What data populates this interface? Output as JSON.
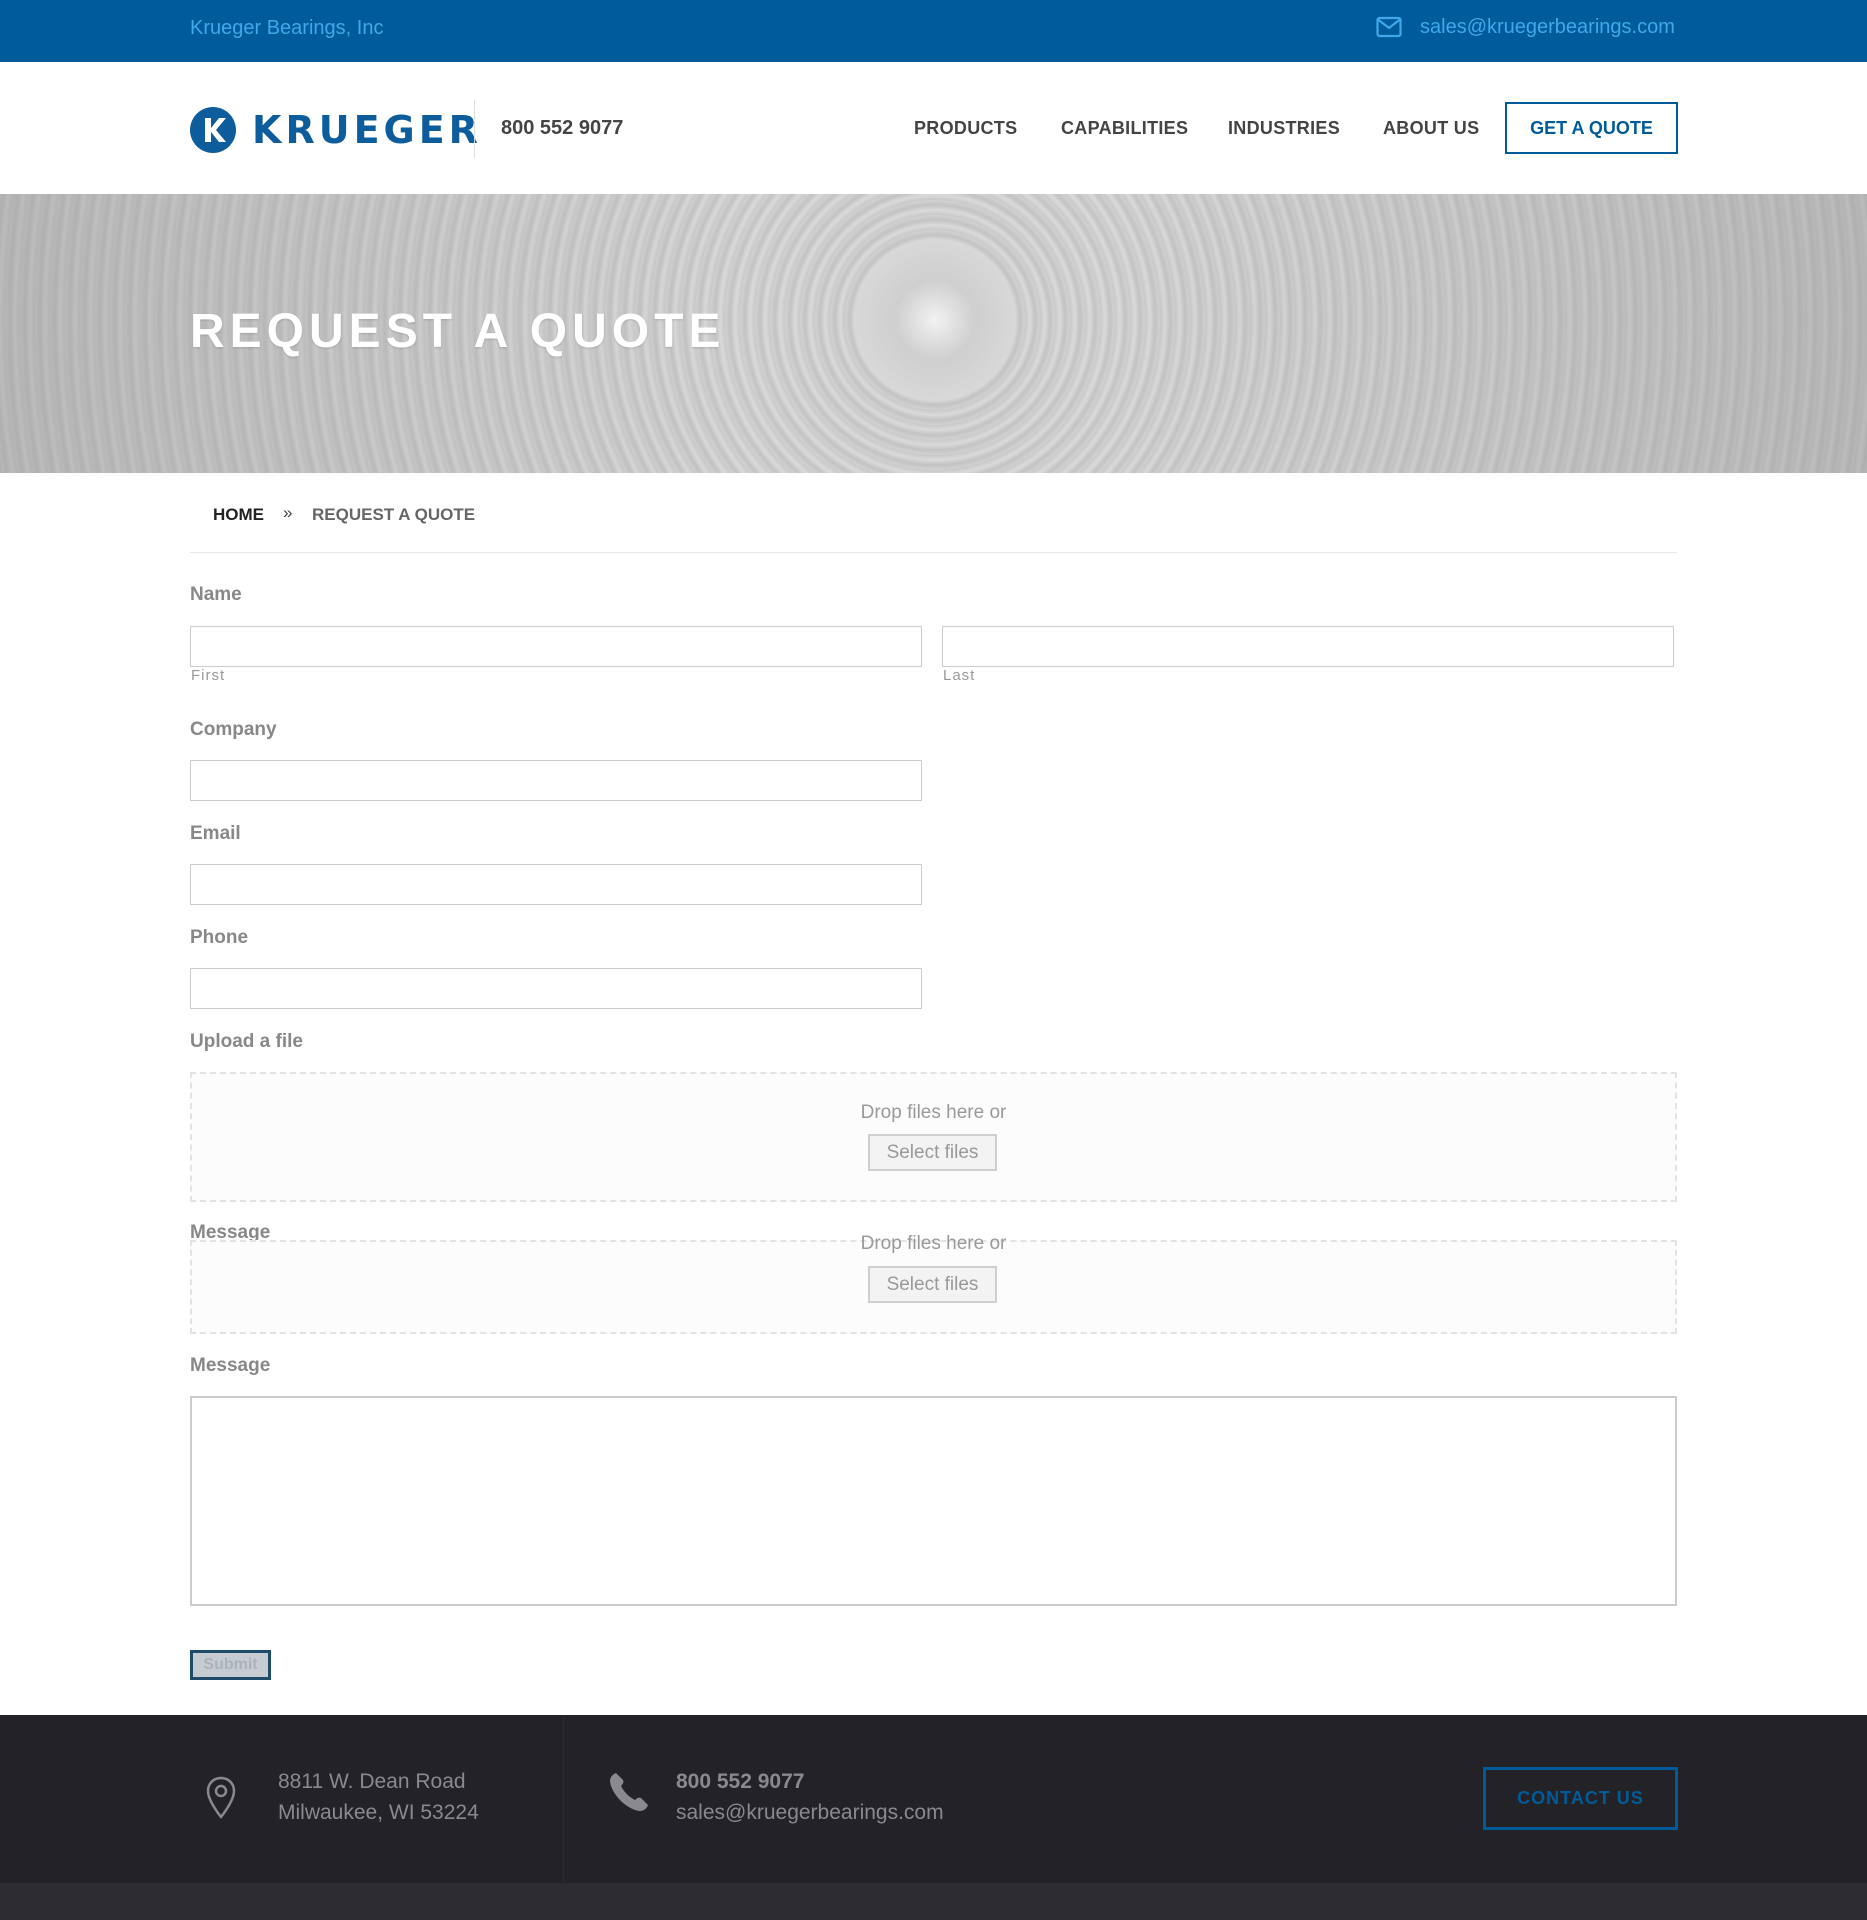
{
  "topbar": {
    "company": "Krueger Bearings, Inc",
    "email": "sales@kruegerbearings.com",
    "mail_icon": "envelope-icon"
  },
  "header": {
    "logo_text": "KRUEGER",
    "phone": "800 552 9077",
    "nav": [
      "PRODUCTS",
      "CAPABILITIES",
      "INDUSTRIES",
      "ABOUT US"
    ],
    "quote_button": "GET A QUOTE"
  },
  "hero": {
    "title": "REQUEST A QUOTE"
  },
  "breadcrumb": {
    "home": "HOME",
    "separator": "»",
    "current": "REQUEST A QUOTE"
  },
  "form": {
    "name_label": "Name",
    "first_sublabel": "First",
    "last_sublabel": "Last",
    "company_label": "Company",
    "email_label": "Email",
    "phone_label": "Phone",
    "upload_label": "Upload a file",
    "drop_text": "Drop files here or",
    "select_files": "Select files",
    "message_label_partial": "Message",
    "message_label": "Message",
    "submit": "Submit"
  },
  "footer": {
    "address_line1": "8811 W. Dean Road",
    "address_line2": "Milwaukee, WI 53224",
    "phone": "800 552 9077",
    "email": "sales@kruegerbearings.com",
    "contact_button": "CONTACT US",
    "pin_icon": "map-pin-icon",
    "phone_icon": "phone-icon"
  },
  "colors": {
    "brand_blue": "#005b9a",
    "link_blue": "#3fa9ea",
    "footer_bg": "#222227"
  }
}
